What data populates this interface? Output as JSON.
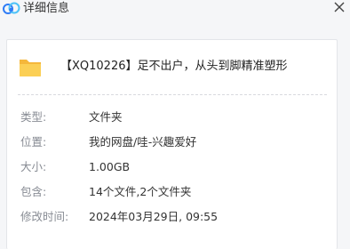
{
  "window": {
    "title": "详细信息",
    "app_icon": "baidu-netdisk-cloud-icon",
    "close_icon": "close-icon"
  },
  "folder": {
    "icon": "folder-icon",
    "icon_color": "#f7c34a",
    "name": "【XQ10226】足不出户，从头到脚精准塑形"
  },
  "details": [
    {
      "label": "类型:",
      "value": "文件夹"
    },
    {
      "label": "位置:",
      "value": "我的网盘/哇-兴趣爱好"
    },
    {
      "label": "大小:",
      "value": "1.00GB"
    },
    {
      "label": "包含:",
      "value": "14个文件,2个文件夹"
    },
    {
      "label": "修改时间:",
      "value": "2024年03月29日, 09:55"
    }
  ]
}
